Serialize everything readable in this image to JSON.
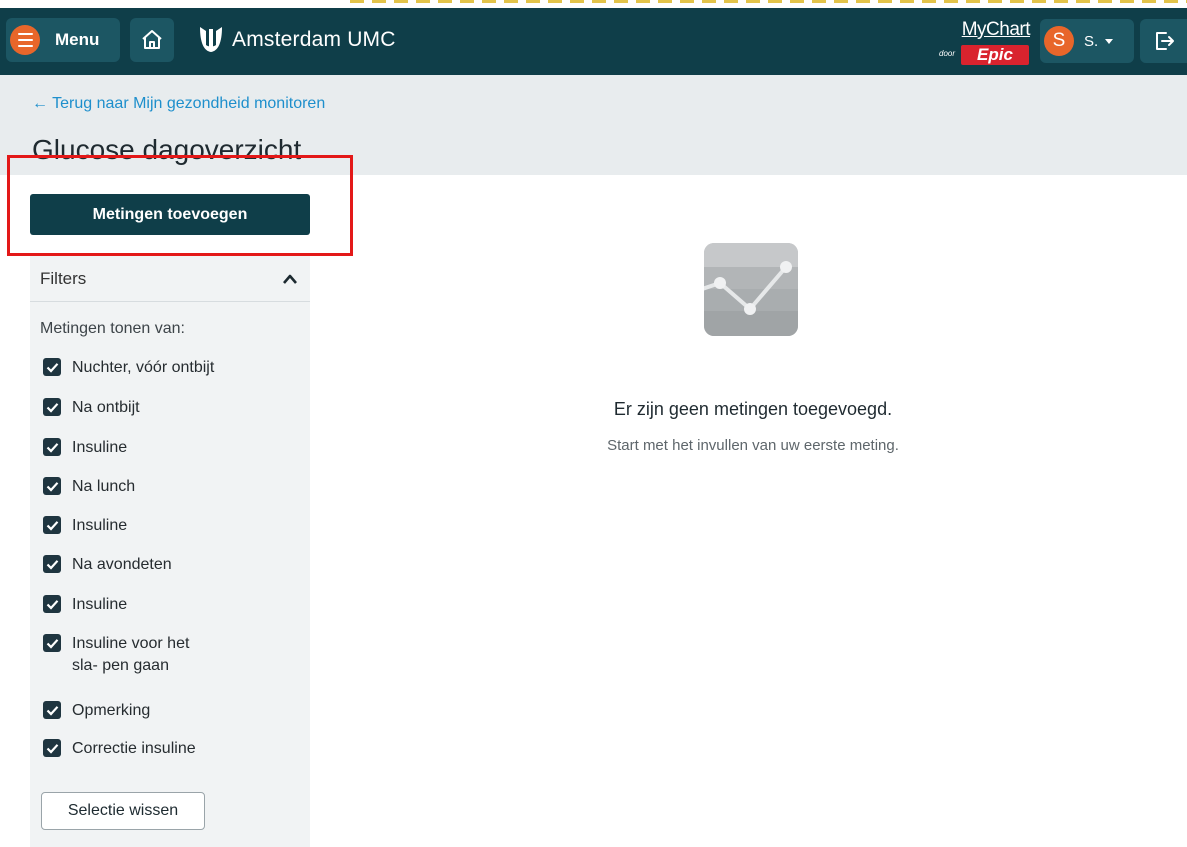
{
  "header": {
    "menu_label": "Menu",
    "logo_text": "Amsterdam UMC",
    "mychart_text": "MyChart",
    "door_text": "door",
    "epic_text": "Epic",
    "user_initial": "S",
    "user_name": "S.",
    "icons": [
      "menu-icon",
      "home-icon",
      "tulip-logo-icon",
      "caret-down-icon",
      "logout-icon"
    ]
  },
  "page": {
    "back_link": "← Terug naar Mijn gezondheid monitoren",
    "title": "Glucose dagoverzicht"
  },
  "actions": {
    "add_measurements": "Metingen toevoegen"
  },
  "filters": {
    "title": "Filters",
    "subtitle": "Metingen tonen van:",
    "items": [
      {
        "label": "Nuchter, vóór ontbijt",
        "checked": true
      },
      {
        "label": "Na ontbijt",
        "checked": true
      },
      {
        "label": "Insuline",
        "checked": true
      },
      {
        "label": "Na lunch",
        "checked": true
      },
      {
        "label": "Insuline",
        "checked": true
      },
      {
        "label": "Na avondeten",
        "checked": true
      },
      {
        "label": "Insuline",
        "checked": true
      },
      {
        "label": "Insuline voor het sla- pen gaan",
        "checked": true
      },
      {
        "label": "Opmerking",
        "checked": true
      },
      {
        "label": "Correctie insuline",
        "checked": true
      }
    ],
    "clear_button": "Selectie wissen"
  },
  "empty_state": {
    "icon": "line-chart-icon",
    "title": "Er zijn geen metingen toegevoegd.",
    "subtitle": "Start met het invullen van uw eerste meting."
  },
  "colors": {
    "header_bg": "#0f3e49",
    "accent_orange": "#e8662a",
    "link_blue": "#1e8fcc",
    "highlight_red": "#e31818",
    "epic_red": "#d9232e"
  }
}
